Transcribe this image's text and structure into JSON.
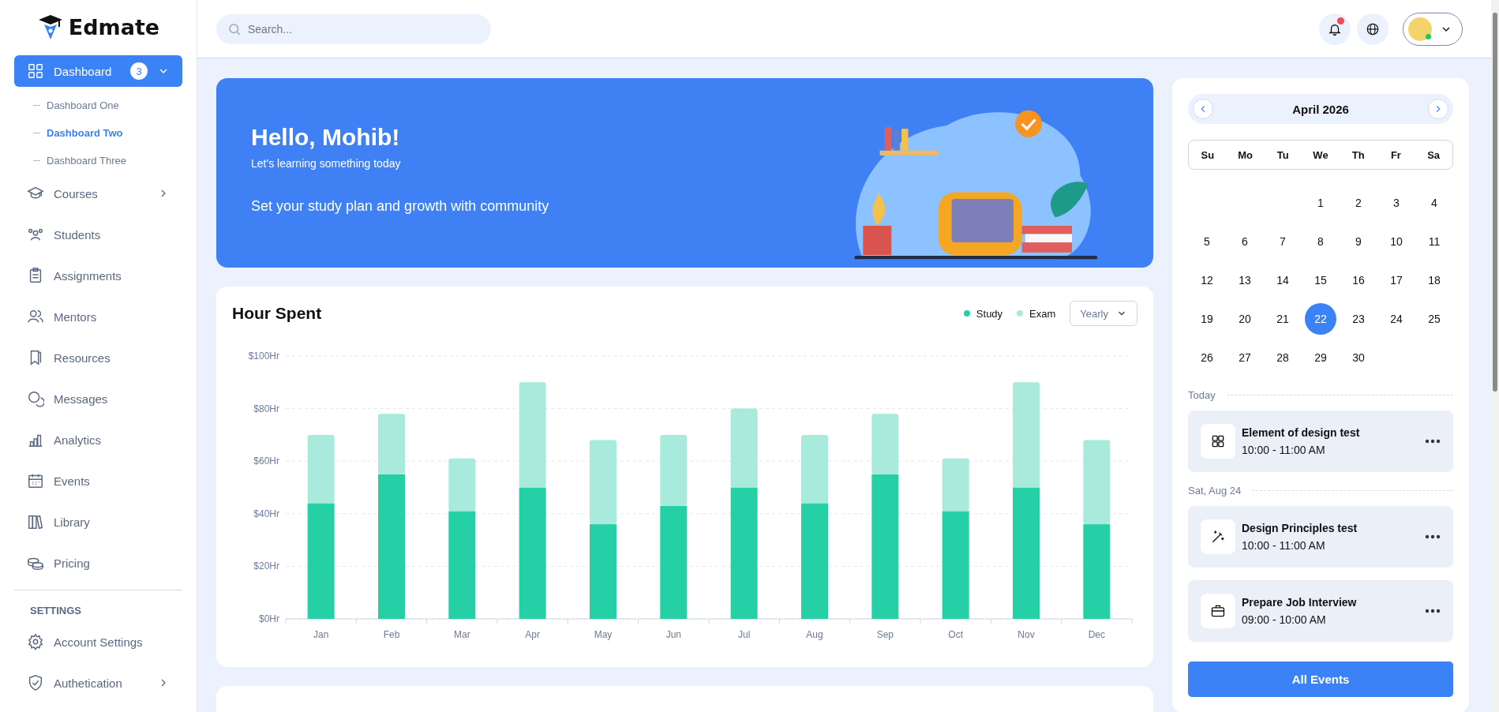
{
  "sidebar": {
    "logo": "Edmate",
    "items": [
      {
        "label": "Dashboard",
        "kind": "grid",
        "selected": true,
        "badge": "3",
        "expanded": true,
        "children": [
          {
            "label": "Dashboard One",
            "selected": false
          },
          {
            "label": "Dashboard Two",
            "selected": true
          },
          {
            "label": "Dashboard Three",
            "selected": false
          }
        ]
      },
      {
        "label": "Courses",
        "kind": "cap",
        "selected": false,
        "expanded": false
      },
      {
        "label": "Students",
        "kind": "users",
        "selected": false
      },
      {
        "label": "Assignments",
        "kind": "clipboard",
        "selected": false
      },
      {
        "label": "Mentors",
        "kind": "people",
        "selected": false
      },
      {
        "label": "Resources",
        "kind": "bookmark",
        "selected": false
      },
      {
        "label": "Messages",
        "kind": "chat",
        "selected": false
      },
      {
        "label": "Analytics",
        "kind": "bars",
        "selected": false
      },
      {
        "label": "Events",
        "kind": "calendar",
        "selected": false
      },
      {
        "label": "Library",
        "kind": "books",
        "selected": false
      },
      {
        "label": "Pricing",
        "kind": "coins",
        "selected": false
      }
    ],
    "settings_heading": "SETTINGS",
    "settings_items": [
      {
        "label": "Account Settings",
        "kind": "gear",
        "selected": false
      },
      {
        "label": "Authetication",
        "kind": "shield",
        "selected": false,
        "expanded": false
      }
    ]
  },
  "header": {
    "search": {
      "placeholder": "Search..."
    },
    "notifications_unread": true,
    "user_online": true
  },
  "banner": {
    "title": "Hello, Mohib!",
    "subtitle": "Let's learning something today",
    "text": "Set your study plan and growth with community"
  },
  "hours_card": {
    "title": "Hour Spent",
    "period_select": "Yearly",
    "chart_data": {
      "type": "bar",
      "stacked": true,
      "grid": true,
      "categories": [
        "Jan",
        "Feb",
        "Mar",
        "Apr",
        "May",
        "Jun",
        "Jul",
        "Aug",
        "Sep",
        "Oct",
        "Nov",
        "Dec"
      ],
      "series": [
        {
          "name": "Study",
          "color": "#26d0a6",
          "values": [
            44,
            55,
            41,
            50,
            36,
            43,
            50,
            44,
            55,
            41,
            50,
            36
          ]
        },
        {
          "name": "Exam",
          "color": "#a8eadb",
          "values": [
            26,
            23,
            20,
            40,
            32,
            27,
            30,
            26,
            23,
            20,
            40,
            32
          ]
        }
      ],
      "ylim": [
        0,
        100
      ],
      "yticks": [
        {
          "value": 0,
          "label": "$0Hr"
        },
        {
          "value": 20,
          "label": "$20Hr"
        },
        {
          "value": 40,
          "label": "$40Hr"
        },
        {
          "value": 60,
          "label": "$60Hr"
        },
        {
          "value": 80,
          "label": "$80Hr"
        },
        {
          "value": 100,
          "label": "$100Hr"
        }
      ]
    }
  },
  "calendar": {
    "month": "April 2026",
    "weekdays": [
      "Su",
      "Mo",
      "Tu",
      "We",
      "Th",
      "Fr",
      "Sa"
    ],
    "weeks": [
      [
        {
          "day": "1",
          "selected": false
        },
        {
          "day": "2",
          "selected": false
        },
        {
          "day": "3",
          "selected": false
        },
        {
          "day": "4",
          "selected": false
        }
      ],
      [
        {
          "day": "5",
          "selected": false
        },
        {
          "day": "6",
          "selected": false
        },
        {
          "day": "7",
          "selected": false
        },
        {
          "day": "8",
          "selected": false
        },
        {
          "day": "9",
          "selected": false
        },
        {
          "day": "10",
          "selected": false
        },
        {
          "day": "11",
          "selected": false
        }
      ],
      [
        {
          "day": "12",
          "selected": false
        },
        {
          "day": "13",
          "selected": false
        },
        {
          "day": "14",
          "selected": false
        },
        {
          "day": "15",
          "selected": false
        },
        {
          "day": "16",
          "selected": false
        },
        {
          "day": "17",
          "selected": false
        },
        {
          "day": "18",
          "selected": false
        }
      ],
      [
        {
          "day": "19",
          "selected": false
        },
        {
          "day": "20",
          "selected": false
        },
        {
          "day": "21",
          "selected": false
        },
        {
          "day": "22",
          "selected": true
        },
        {
          "day": "23",
          "selected": false
        },
        {
          "day": "24",
          "selected": false
        },
        {
          "day": "25",
          "selected": false
        }
      ],
      [
        {
          "day": "26",
          "selected": false
        },
        {
          "day": "27",
          "selected": false
        },
        {
          "day": "28",
          "selected": false
        },
        {
          "day": "29",
          "selected": false
        },
        {
          "day": "30",
          "selected": false
        }
      ]
    ]
  },
  "event_groups": [
    {
      "heading": "Today",
      "events": [
        {
          "title": "Element of design test",
          "time": "10:00 - 11:00 AM",
          "kind": "grid"
        }
      ]
    },
    {
      "heading": "Sat, Aug 24",
      "events": [
        {
          "title": "Design Principles test",
          "time": "10:00 - 11:00 AM",
          "kind": "wand"
        },
        {
          "title": "Prepare Job Interview",
          "time": "09:00 - 10:00 AM",
          "kind": "briefcase"
        }
      ]
    }
  ],
  "all_events_button": "All Events"
}
